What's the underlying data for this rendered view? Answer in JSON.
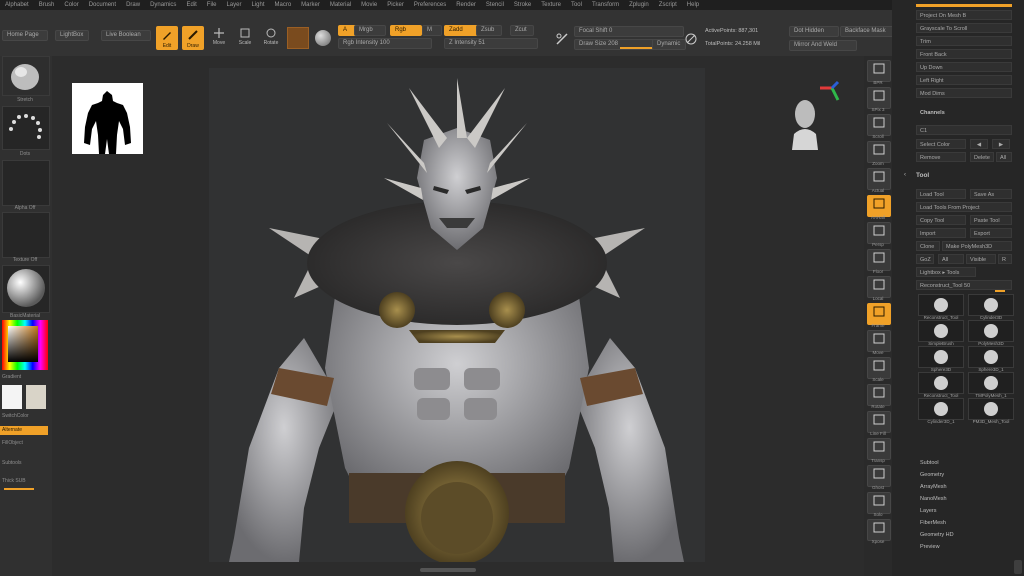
{
  "menu": [
    "Alphabet",
    "Brush",
    "Color",
    "Document",
    "Draw",
    "Dynamics",
    "Edit",
    "File",
    "Layer",
    "Light",
    "Macro",
    "Marker",
    "Material",
    "Movie",
    "Picker",
    "Preferences",
    "Render",
    "Stencil",
    "Stroke",
    "Texture",
    "Tool",
    "Transform",
    "Zplugin",
    "Zscript",
    "Help"
  ],
  "shelf": {
    "home_page": "Home Page",
    "lightbox": "LightBox",
    "live_boolean": "Live Boolean",
    "edit": "Edit",
    "draw": "Draw",
    "move": "Move",
    "scale": "Scale",
    "rotate": "Rotate",
    "a_label": "A",
    "mrgb": "Mrgb",
    "rgb": "Rgb",
    "m_label": "M",
    "zadd": "Zadd",
    "zsub": "Zsub",
    "zcut": "Zcut",
    "rgb_intensity": "Rgb Intensity 100",
    "z_intensity": "Z Intensity 51",
    "focal_shift": "Focal Shift 0",
    "draw_size": "Draw Size 208",
    "dynamic": "Dynamic",
    "active_points": "ActivePoints: 887,301",
    "total_points": "TotalPoints: 24.258 Mil",
    "dot_hidden": "Dot Hidden",
    "backface_mask": "Backface Mask",
    "mirror_weld": "Mirror And Weld"
  },
  "left": {
    "brush_label": "Stretch",
    "stroke_label": "Dots",
    "alpha_label": "Alpha Off",
    "texture_label": "Texture Off",
    "material_label": "BasicMaterial",
    "gradient": "Gradient",
    "switch_color": "SwitchColor",
    "alternate": "Alternate",
    "fill_object": "FillObject",
    "subtools": "Subtools",
    "thick_solid": "Thick SUB"
  },
  "right_shelf": [
    "BPR",
    "SPix 3",
    "Scroll",
    "Zoom",
    "Actual",
    "AAHalf",
    "Persp",
    "Floor",
    "Local",
    "Frame",
    "Move",
    "Scale",
    "Rotate",
    "Line Fill",
    "Transp",
    "Ghost",
    "Solo",
    "Xpose"
  ],
  "tray": {
    "top_items": [
      "Project On Mesh B",
      "Grayscale To Scroll",
      "Trim",
      "Front Back",
      "Up Down",
      "Left Right",
      "Mod Dims"
    ],
    "channels_label": "Channels",
    "channel_value": "C1",
    "select_color": "Select Color",
    "remove": "Remove",
    "delete": "Delete",
    "all": "All",
    "tool_title": "Tool",
    "load_tool": "Load Tool",
    "save_as": "Save As",
    "load_from_project": "Load Tools From Project",
    "copy_tool": "Copy Tool",
    "paste_tool": "Paste Tool",
    "import": "Import",
    "export": "Export",
    "clone": "Clone",
    "make_polymesh": "Make PolyMesh3D",
    "goz": "GoZ",
    "all2": "All",
    "visible": "Visible",
    "r_label": "R",
    "lightbox_tools": "Lightbox ▸ Tools",
    "recon_label": "Reconstruct_Tool  50",
    "thumbs": [
      "Reconstruct_Tool",
      "Cylinder3D",
      "SimpleBrush",
      "PolyMesh3D",
      "Sphere3D",
      "Sphere3D_1",
      "Reconstruct_Tool",
      "TMPolyMesh_1",
      "Cylinder3D_1",
      "PM3D_Mesh_Tool"
    ],
    "bottom_items": [
      "Subtool",
      "Geometry",
      "ArrayMesh",
      "NanoMesh",
      "Layers",
      "FiberMesh",
      "Geometry HD",
      "Preview"
    ]
  },
  "colors": {
    "accent": "#f0a128",
    "bg": "#2b2b2b",
    "canvas": "#313233"
  }
}
